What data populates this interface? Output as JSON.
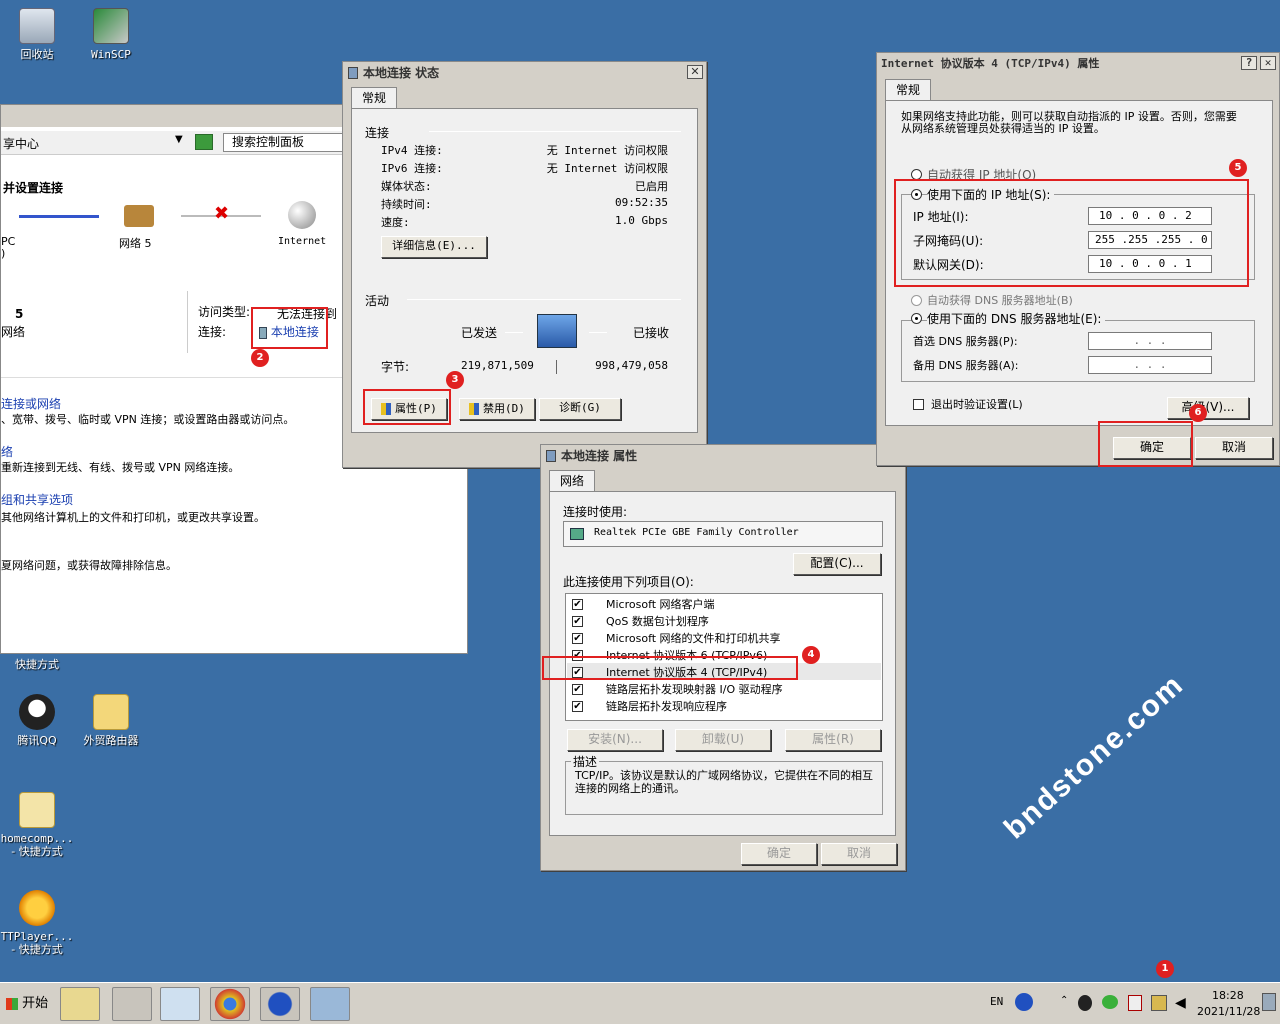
{
  "desktop": {
    "icons": [
      {
        "label": "回收站"
      },
      {
        "label": "WinSCP"
      },
      {
        "label": "快捷方式"
      },
      {
        "label": "腾讯QQ"
      },
      {
        "label": "外贸路由器"
      },
      {
        "label": "homecomp...",
        "sub": "- 快捷方式"
      },
      {
        "label": "TTPlayer...",
        "sub": "- 快捷方式"
      }
    ],
    "watermark": "bndstone.com"
  },
  "network_center": {
    "breadcrumb": "享中心",
    "search_placeholder": "搜索控制面板",
    "heading": "并设置连接",
    "pc_label": "PC",
    "pc_sub": ")",
    "network_label": "网络 5",
    "internet_label": "Internet",
    "net_num": "5",
    "net_type": "网络",
    "access_type_label": "访问类型:",
    "access_type_value": "无法连接到",
    "connection_label": "连接:",
    "connection_link": "本地连接",
    "tasks": [
      {
        "title": "连接或网络",
        "desc": "、宽带、拨号、临时或 VPN 连接；或设置路由器或访问点。"
      },
      {
        "title": "络",
        "desc": "重新连接到无线、有线、拨号或 VPN 网络连接。"
      },
      {
        "title": "组和共享选项",
        "desc": "其他网络计算机上的文件和打印机，或更改共享设置。"
      },
      {
        "title": "",
        "desc": "夏网络问题，或获得故障排除信息。"
      }
    ]
  },
  "status_dialog": {
    "title": "本地连接 状态",
    "close": "✕",
    "tab": "常规",
    "connection_group": "连接",
    "rows": [
      {
        "label": "IPv4 连接:",
        "value": "无 Internet 访问权限"
      },
      {
        "label": "IPv6 连接:",
        "value": "无 Internet 访问权限"
      },
      {
        "label": "媒体状态:",
        "value": "已启用"
      },
      {
        "label": "持续时间:",
        "value": "09:52:35"
      },
      {
        "label": "速度:",
        "value": "1.0 Gbps"
      }
    ],
    "details_btn": "详细信息(E)...",
    "activity_group": "活动",
    "sent_label": "已发送",
    "recv_label": "已接收",
    "bytes_label": "字节:",
    "bytes_sent": "219,871,509",
    "bytes_recv": "998,479,058",
    "buttons": {
      "properties": "属性(P)",
      "disable": "禁用(D)",
      "diagnose": "诊断(G)"
    }
  },
  "props_dialog": {
    "title": "本地连接 属性",
    "tab": "网络",
    "connect_using_label": "连接时使用:",
    "adapter": "Realtek PCIe GBE Family Controller",
    "configure_btn": "配置(C)...",
    "items_label": "此连接使用下列项目(O):",
    "items": [
      {
        "label": "Microsoft 网络客户端",
        "checked": "✔"
      },
      {
        "label": "QoS 数据包计划程序",
        "checked": "✔"
      },
      {
        "label": "Microsoft 网络的文件和打印机共享",
        "checked": "✔"
      },
      {
        "label": "Internet 协议版本 6 (TCP/IPv6)",
        "checked": "✔"
      },
      {
        "label": "Internet 协议版本 4 (TCP/IPv4)",
        "checked": "✔"
      },
      {
        "label": "链路层拓扑发现映射器 I/O 驱动程序",
        "checked": "✔"
      },
      {
        "label": "链路层拓扑发现响应程序",
        "checked": "✔"
      }
    ],
    "install_btn": "安装(N)...",
    "uninstall_btn": "卸载(U)",
    "properties_btn": "属性(R)",
    "desc_group": "描述",
    "desc_text": "TCP/IP。该协议是默认的广域网络协议，它提供在不同的相互连接的网络上的通讯。",
    "ok_btn": "确定",
    "cancel_btn": "取消"
  },
  "ipv4_dialog": {
    "title": "Internet 协议版本 4 (TCP/IPv4) 属性",
    "help": "?",
    "close": "✕",
    "tab": "常规",
    "intro": "如果网络支持此功能，则可以获取自动指派的 IP 设置。否则，您需要从网络系统管理员处获得适当的 IP 设置。",
    "auto_ip": "自动获得 IP 地址(O)",
    "manual_ip": "使用下面的 IP 地址(S):",
    "ip_label": "IP 地址(I):",
    "ip_value": "10 . 0 . 0 . 2",
    "mask_label": "子网掩码(U):",
    "mask_value": "255 .255 .255 . 0",
    "gw_label": "默认网关(D):",
    "gw_value": "10 . 0 . 0 . 1",
    "auto_dns": "自动获得 DNS 服务器地址(B)",
    "manual_dns": "使用下面的 DNS 服务器地址(E):",
    "dns1_label": "首选 DNS 服务器(P):",
    "dns2_label": "备用 DNS 服务器(A):",
    "dns_empty": ". . .",
    "validate_label": "退出时验证设置(L)",
    "advanced_btn": "高级(V)...",
    "ok_btn": "确定",
    "cancel_btn": "取消"
  },
  "badges": [
    "1",
    "2",
    "3",
    "4",
    "5",
    "6"
  ],
  "taskbar": {
    "start": "开始",
    "lang": "EN",
    "time": "18:28",
    "date": "2021/11/28"
  },
  "colors": {
    "desktop": "#3a6ea5",
    "highlight_box": "#e02020"
  }
}
